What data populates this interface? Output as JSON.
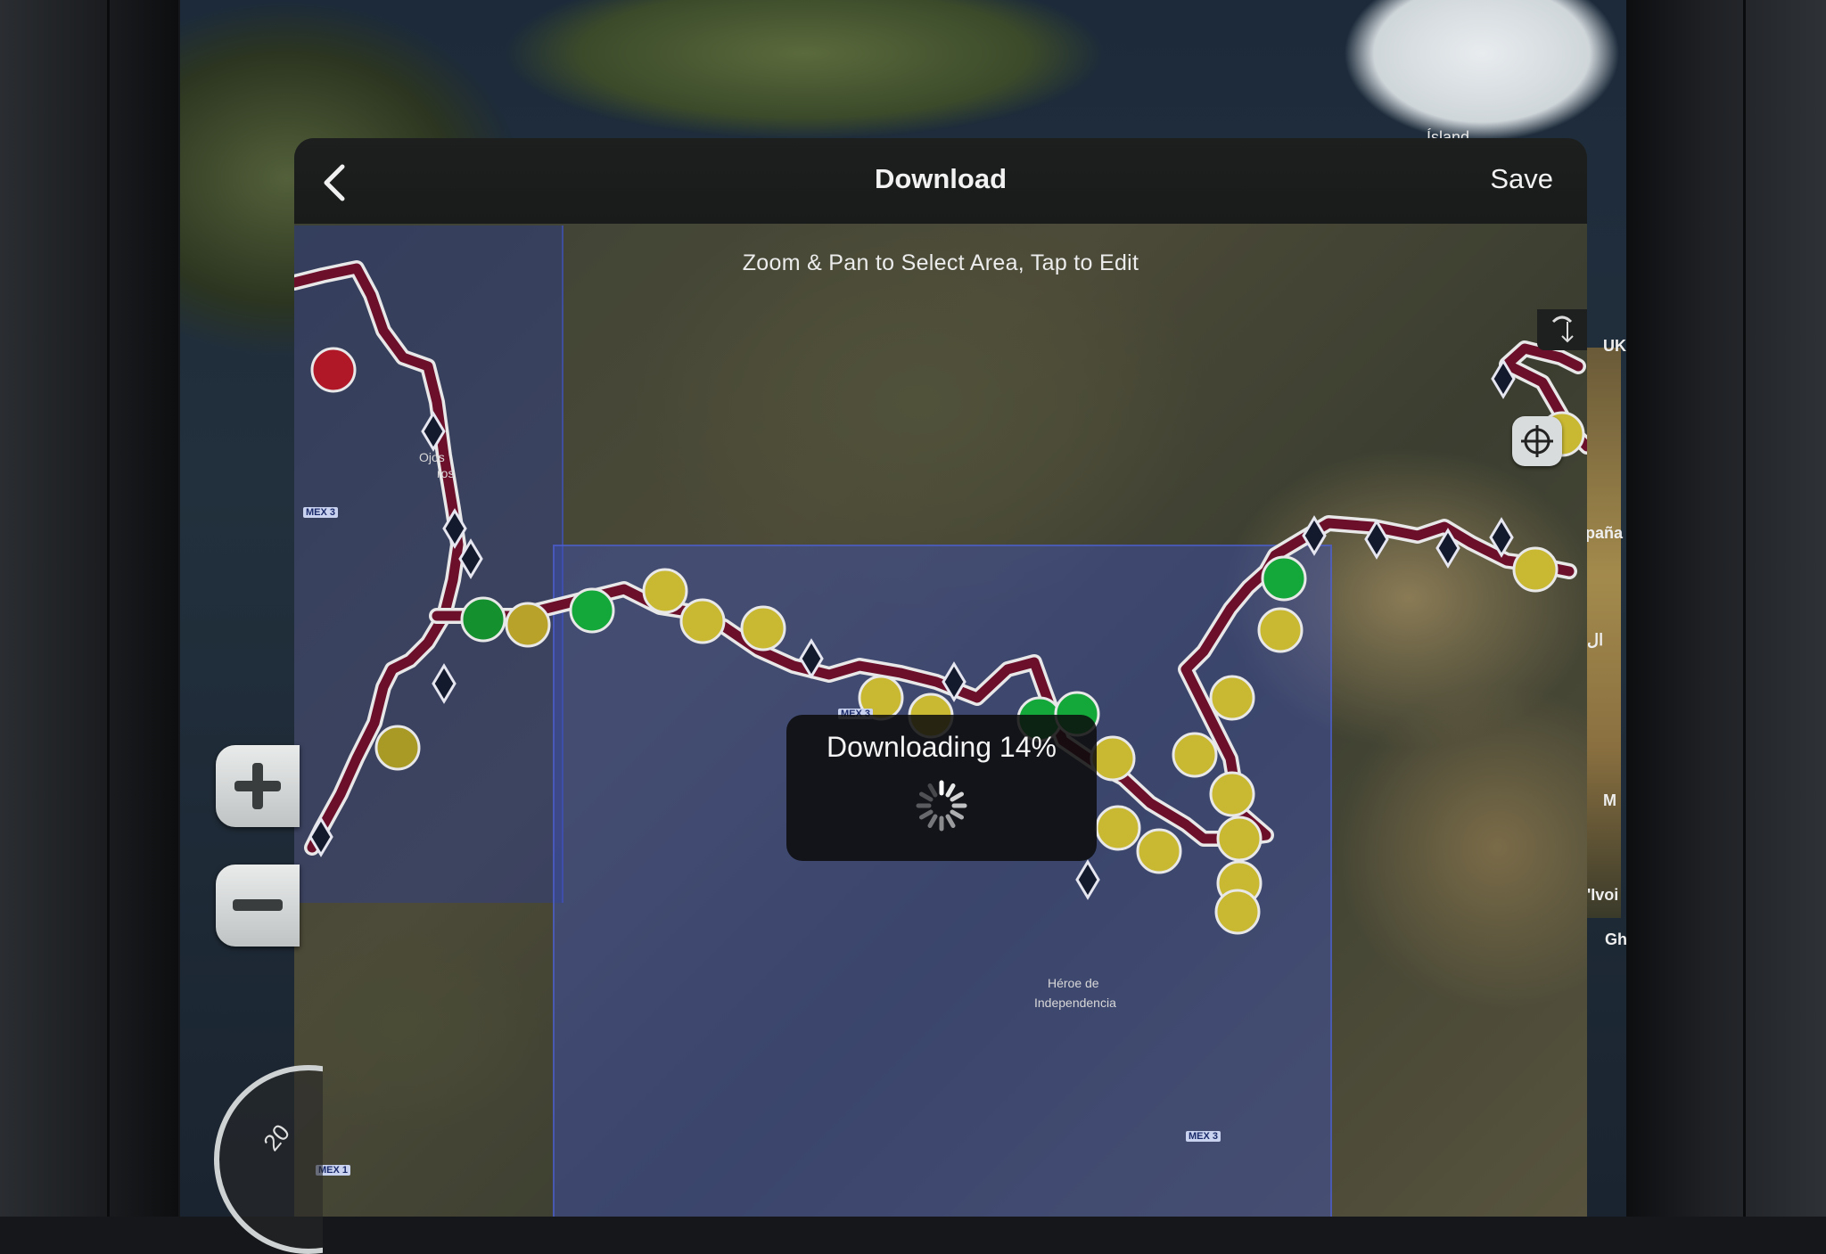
{
  "topbar": {
    "title": "Download",
    "save_label": "Save",
    "back_icon": "chevron-left-icon"
  },
  "map": {
    "hint": "Zoom & Pan to Select Area, Tap to Edit",
    "labels": {
      "island": "Ísland",
      "ojos": "Ojos",
      "ros": "ros",
      "heroes": "Héroe de",
      "independencia": "Independencia",
      "side_uk": "UK",
      "side_espana": "paña",
      "side_al": "ال",
      "side_m": "M",
      "side_ivoi": "'Ivoi",
      "side_gh": "Gh"
    },
    "roads": {
      "mex3_a": "MEX 3",
      "mex3_b": "MEX 3",
      "mex3_c": "MEX 3",
      "mex1": "MEX 1"
    }
  },
  "progress": {
    "text": "Downloading 14%",
    "percent": 14
  },
  "controls": {
    "zoom_in_icon": "plus-icon",
    "zoom_out_icon": "minus-icon",
    "recenter_icon": "crosshair-icon",
    "compass_value": "20"
  },
  "colors": {
    "route": "#6b0f2a",
    "waypoint_yellow": "#c9b832",
    "waypoint_green": "#14a83a",
    "waypoint_red": "#c01a2a",
    "selection": "#3c50b9"
  }
}
